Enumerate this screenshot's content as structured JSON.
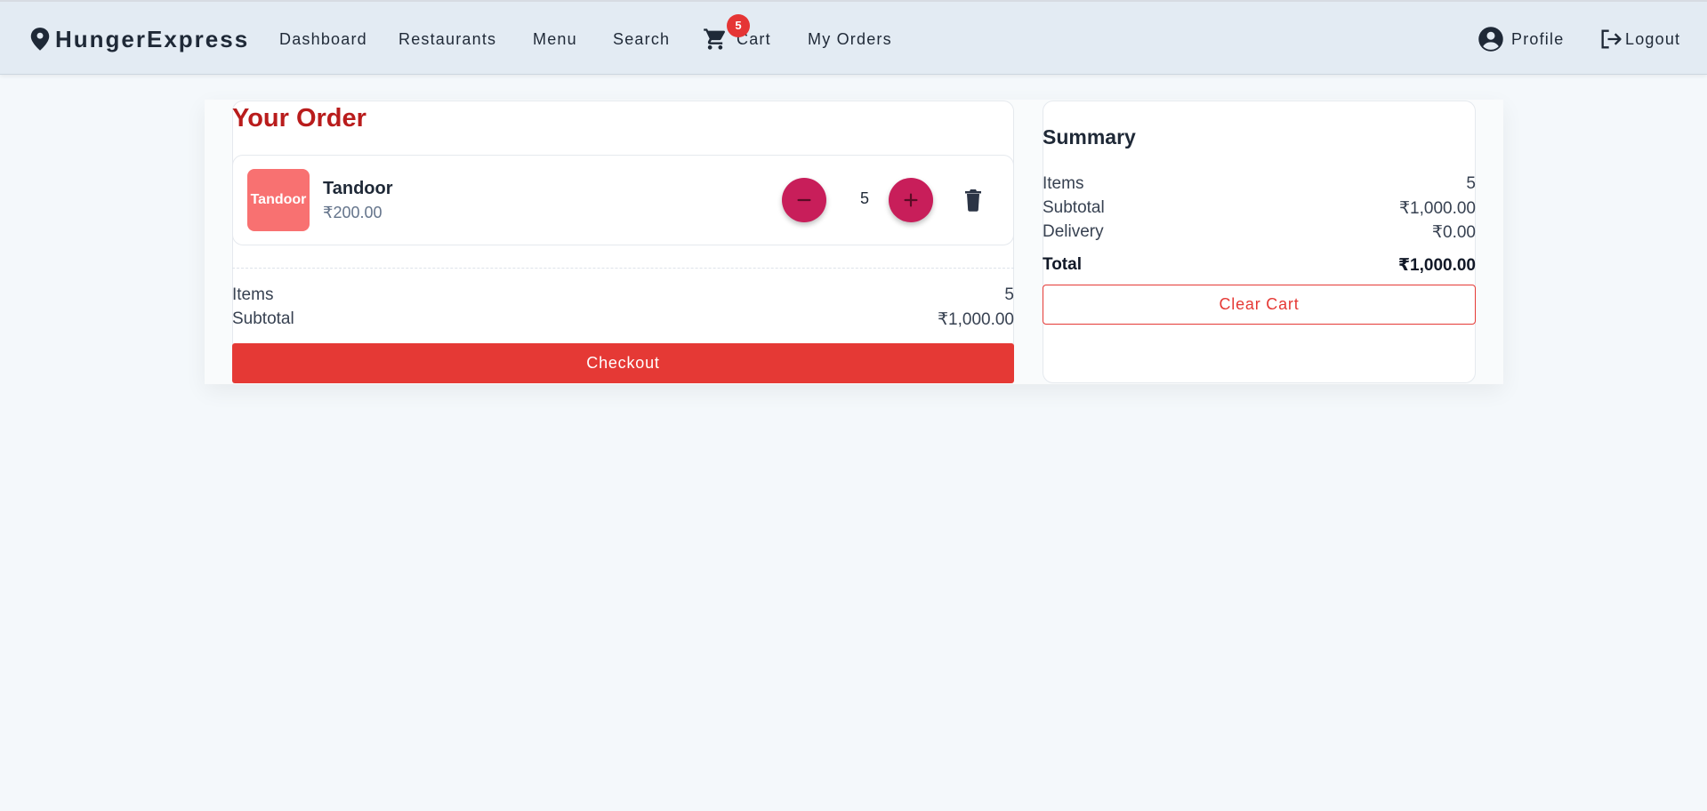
{
  "navbar": {
    "brand": "HungerExpress",
    "links": {
      "dashboard": "Dashboard",
      "restaurants": "Restaurants",
      "menu": "Menu",
      "search": "Search",
      "cart": "Cart",
      "my_orders": "My Orders",
      "profile": "Profile",
      "logout": "Logout"
    },
    "cart_badge": "5"
  },
  "order": {
    "title": "Your Order",
    "items": [
      {
        "thumb_label": "Tandoor",
        "name": "Tandoor",
        "price": "₹200.00",
        "quantity": "5"
      }
    ],
    "summary": {
      "items_label": "Items",
      "items_value": "5",
      "subtotal_label": "Subtotal",
      "subtotal_value": "₹1,000.00"
    },
    "checkout_label": "Checkout"
  },
  "summary": {
    "title": "Summary",
    "items_label": "Items",
    "items_value": "5",
    "subtotal_label": "Subtotal",
    "subtotal_value": "₹1,000.00",
    "delivery_label": "Delivery",
    "delivery_value": "₹0.00",
    "total_label": "Total",
    "total_value": "₹1,000.00",
    "clear_label": "Clear Cart"
  },
  "colors": {
    "accent": "#e53935",
    "title_red": "#b91c1c",
    "qty_button": "#c81e5a",
    "thumb_bg": "#f87171",
    "navbar_bg": "#e3ebf3"
  },
  "icons": {
    "brand": "location-pin-icon",
    "cart": "cart-icon",
    "profile": "user-circle-icon",
    "logout": "logout-icon",
    "decrement": "minus-icon",
    "increment": "plus-icon",
    "delete": "trash-icon"
  }
}
